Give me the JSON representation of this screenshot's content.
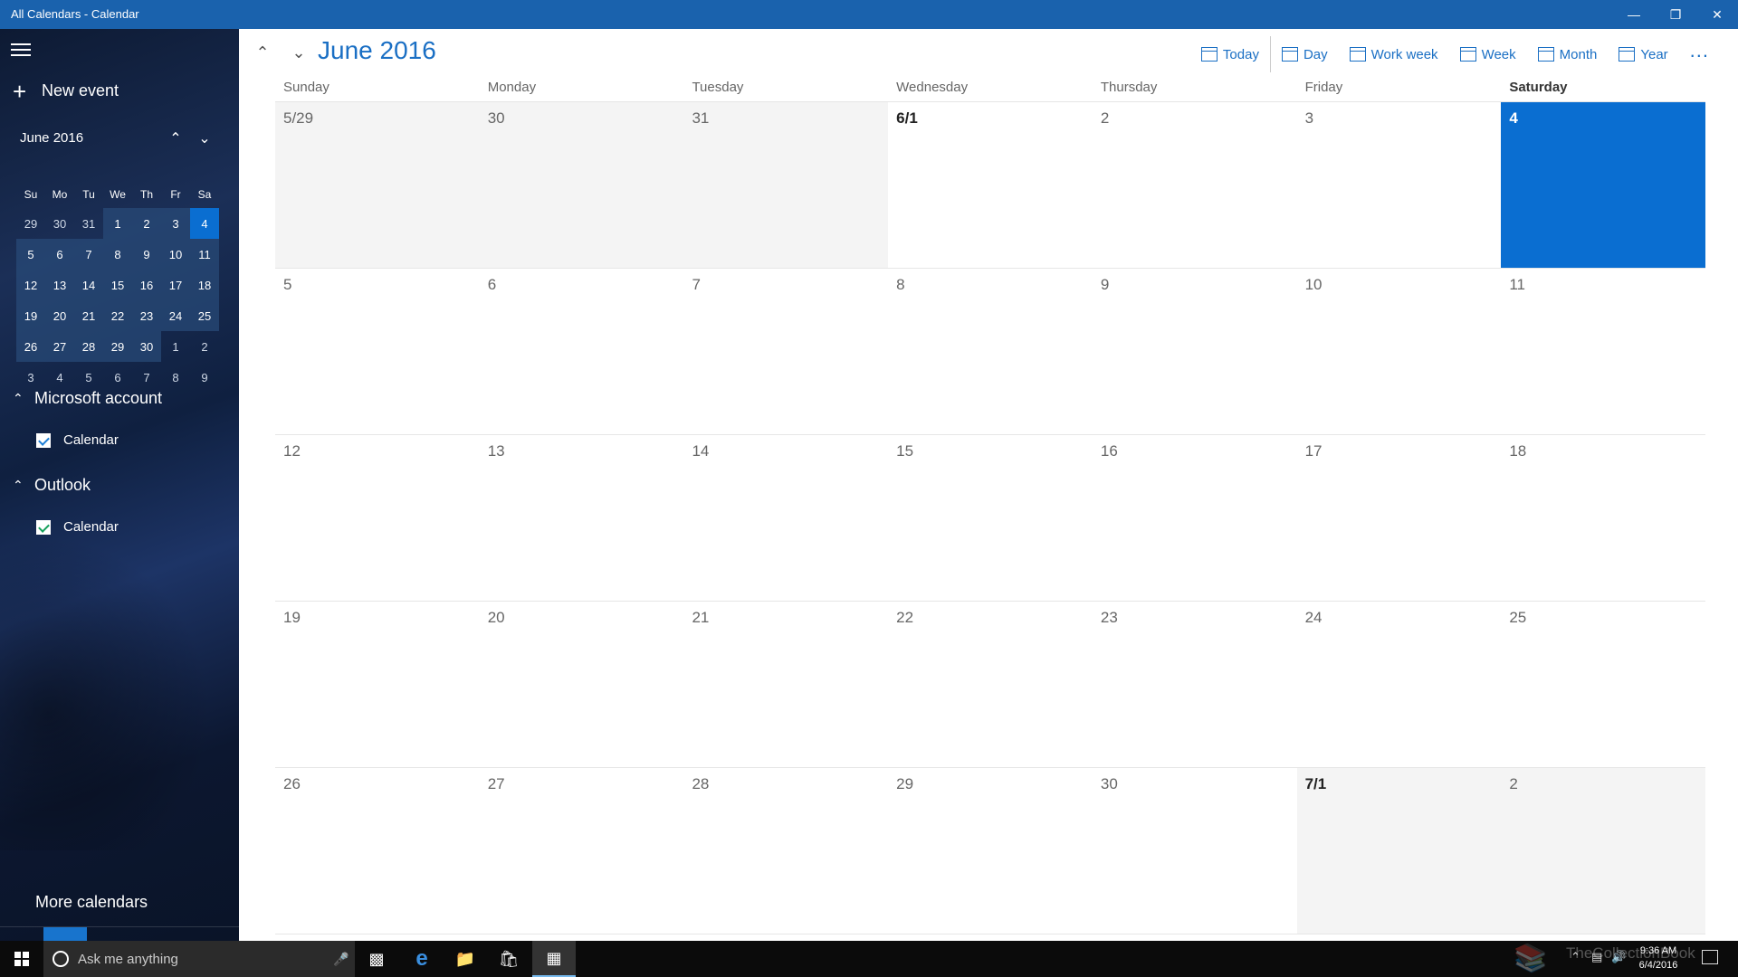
{
  "window": {
    "title": "All Calendars - Calendar"
  },
  "sidebar": {
    "new_event_label": "New event",
    "mini_calendar": {
      "title": "June 2016",
      "weekday_headers": [
        "Su",
        "Mo",
        "Tu",
        "We",
        "Th",
        "Fr",
        "Sa"
      ],
      "weeks": [
        [
          "29",
          "30",
          "31",
          "1",
          "2",
          "3",
          "4"
        ],
        [
          "5",
          "6",
          "7",
          "8",
          "9",
          "10",
          "11"
        ],
        [
          "12",
          "13",
          "14",
          "15",
          "16",
          "17",
          "18"
        ],
        [
          "19",
          "20",
          "21",
          "22",
          "23",
          "24",
          "25"
        ],
        [
          "26",
          "27",
          "28",
          "29",
          "30",
          "1",
          "2"
        ],
        [
          "3",
          "4",
          "5",
          "6",
          "7",
          "8",
          "9"
        ]
      ]
    },
    "accounts": [
      {
        "name": "Microsoft account",
        "calendar_label": "Calendar",
        "check_color": "#1e7fd6"
      },
      {
        "name": "Outlook",
        "calendar_label": "Calendar",
        "check_color": "#16a05b"
      }
    ],
    "more_calendars_label": "More calendars"
  },
  "main": {
    "month_title": "June 2016",
    "toolbar": {
      "today": "Today",
      "day": "Day",
      "work_week": "Work week",
      "week": "Week",
      "month": "Month",
      "year": "Year",
      "more": "..."
    },
    "weekdays": [
      "Sunday",
      "Monday",
      "Tuesday",
      "Wednesday",
      "Thursday",
      "Friday",
      "Saturday"
    ],
    "weeks": [
      [
        "5/29",
        "30",
        "31",
        "6/1",
        "2",
        "3",
        "4"
      ],
      [
        "5",
        "6",
        "7",
        "8",
        "9",
        "10",
        "11"
      ],
      [
        "12",
        "13",
        "14",
        "15",
        "16",
        "17",
        "18"
      ],
      [
        "19",
        "20",
        "21",
        "22",
        "23",
        "24",
        "25"
      ],
      [
        "26",
        "27",
        "28",
        "29",
        "30",
        "7/1",
        "2"
      ]
    ]
  },
  "taskbar": {
    "search_placeholder": "Ask me anything",
    "clock_time": "9:36 AM",
    "clock_date": "6/4/2016",
    "watermark": "TheCollectionBook"
  },
  "colors": {
    "accent": "#0a6ed1",
    "titlebar": "#1a62ad"
  }
}
